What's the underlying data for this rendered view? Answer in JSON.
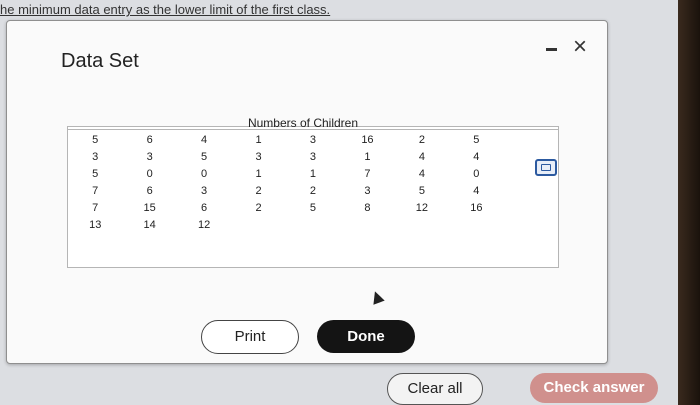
{
  "background_text": "he minimum data entry as the lower limit of the first class.",
  "dialog": {
    "title": "Data Set",
    "minimize_icon": "minimize-icon",
    "close_icon": "close-icon",
    "close_glyph": "×"
  },
  "table": {
    "heading": "Numbers of Children",
    "columns": [
      [
        "5",
        "3",
        "5",
        "7",
        "7",
        "13"
      ],
      [
        "6",
        "3",
        "0",
        "6",
        "15",
        "14"
      ],
      [
        "4",
        "5",
        "0",
        "3",
        "6",
        "12"
      ],
      [
        "1",
        "3",
        "1",
        "2",
        "2"
      ],
      [
        "3",
        "3",
        "1",
        "2",
        "5"
      ],
      [
        "16",
        "1",
        "7",
        "3",
        "8"
      ],
      [
        "2",
        "4",
        "4",
        "5",
        "12"
      ],
      [
        "5",
        "4",
        "0",
        "4",
        "16"
      ],
      []
    ],
    "copy_icon": "copy-to-clipboard-icon"
  },
  "buttons": {
    "print": "Print",
    "done": "Done",
    "clear_all": "Clear all",
    "check_answer": "Check answer"
  },
  "colors": {
    "done_bg": "#141414",
    "check_answer_bg": "#d0908d",
    "copy_icon": "#2c5aa0"
  }
}
